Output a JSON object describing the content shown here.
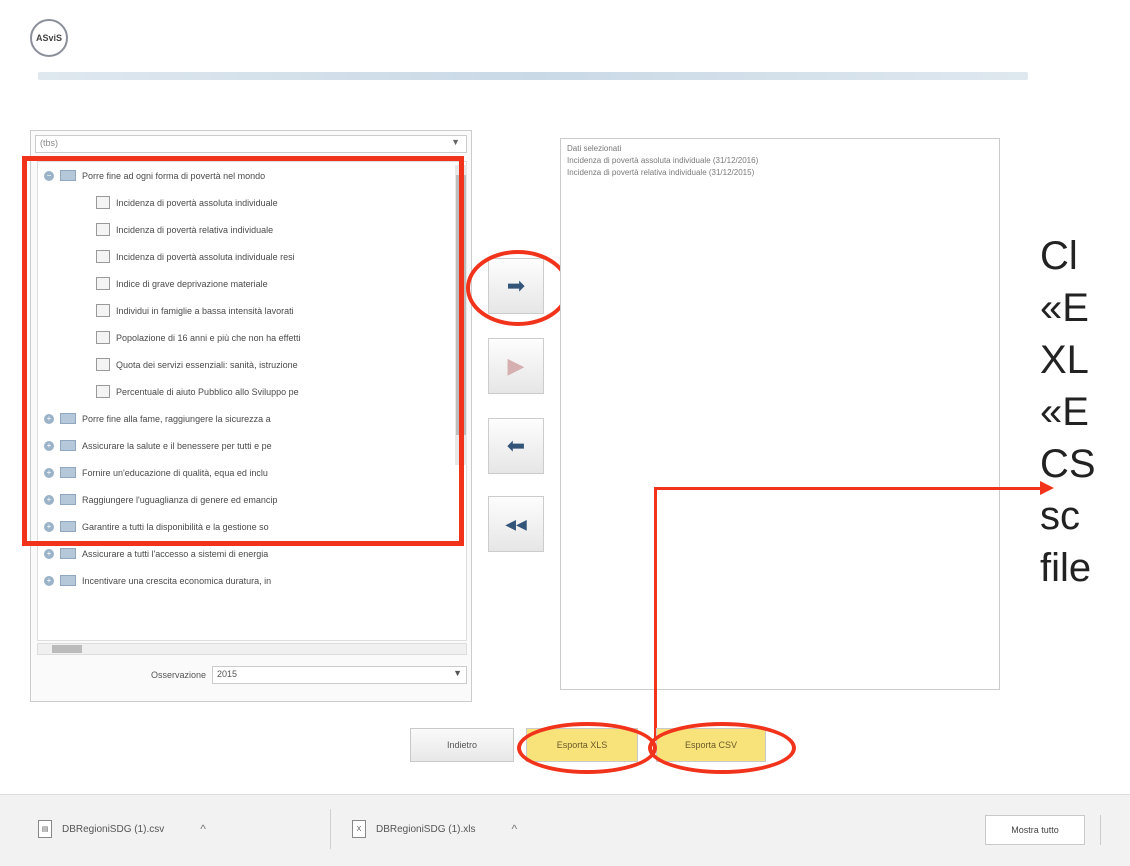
{
  "header": {
    "logo_text": "ASviS"
  },
  "left_panel": {
    "dropdown_value": "(tbs)",
    "tree": [
      {
        "level": 0,
        "label": "Porre fine ad ogni forma di povertà nel mondo",
        "expanded": true
      },
      {
        "level": 1,
        "label": "Incidenza di povertà assoluta individuale"
      },
      {
        "level": 1,
        "label": "Incidenza di povertà relativa individuale"
      },
      {
        "level": 1,
        "label": "Incidenza di povertà assoluta individuale resi"
      },
      {
        "level": 1,
        "label": "Indice di grave deprivazione materiale"
      },
      {
        "level": 1,
        "label": "Individui in famiglie a bassa intensità lavorati"
      },
      {
        "level": 1,
        "label": "Popolazione di 16 anni e più che non ha effetti"
      },
      {
        "level": 1,
        "label": "Quota dei servizi essenziali: sanità, istruzione"
      },
      {
        "level": 1,
        "label": "Percentuale di aiuto Pubblico allo Sviluppo pe"
      },
      {
        "level": 0,
        "label": "Porre fine alla fame, raggiungere la sicurezza a"
      },
      {
        "level": 0,
        "label": "Assicurare la salute e il benessere per tutti e pe"
      },
      {
        "level": 0,
        "label": "Fornire un'educazione di qualità, equa ed inclu"
      },
      {
        "level": 0,
        "label": "Raggiungere l'uguaglianza di genere ed emancip"
      },
      {
        "level": 0,
        "label": "Garantire a tutti la disponibilità e la gestione so"
      },
      {
        "level": 0,
        "label": "Assicurare a tutti l'accesso a sistemi di energia"
      },
      {
        "level": 0,
        "label": "Incentivare una crescita economica duratura, in"
      }
    ],
    "filter_label": "Osservazione",
    "filter_value": "2015"
  },
  "right_panel": {
    "title": "Dati selezionati",
    "items": [
      "Incidenza di povertà assoluta individuale (31/12/2016)",
      "Incidenza di povertà relativa individuale (31/12/2015)"
    ]
  },
  "middle_buttons": {
    "add": "➡",
    "add_all": "▶",
    "remove": "⬅",
    "remove_all": "◀◀"
  },
  "instruction": {
    "lines": [
      "Cl",
      "«E",
      "XL",
      "«E",
      "CS",
      "sc",
      "file"
    ]
  },
  "bottom_buttons": {
    "back": "Indietro",
    "export_xls": "Esporta XLS",
    "export_csv": "Esporta CSV"
  },
  "downloads": {
    "items": [
      {
        "name": "DBRegioniSDG (1).csv",
        "icon": "csv"
      },
      {
        "name": "DBRegioniSDG (1).xls",
        "icon": "xls"
      }
    ],
    "show_all": "Mostra tutto"
  },
  "colors": {
    "highlight": "#f2331b",
    "export_button": "#f8e27a",
    "nav_arrow": "#34557a"
  }
}
